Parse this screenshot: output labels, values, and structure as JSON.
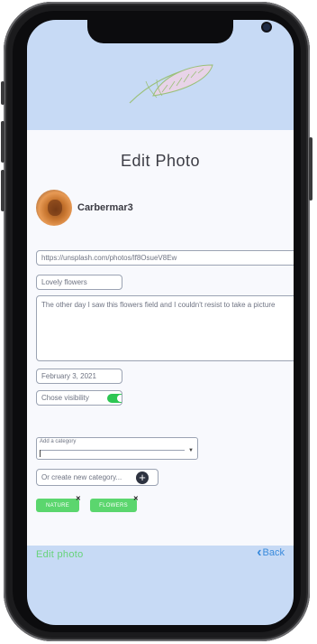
{
  "page": {
    "title": "Edit Photo",
    "user": {
      "name": "Carbermar3"
    },
    "url_value": "https://unsplash.com/photos/lf8OsueV8Ew",
    "title_value": "Lovely flowers",
    "description_value": "The other day I saw this flowers field and I couldn't resist to take a picture",
    "date_value": "February 3, 2021",
    "visibility_label": "Chose visibility",
    "category_label": "Add a category",
    "new_category_placeholder": "Or create new category...",
    "tags": [
      "NATURE",
      "FLOWERS"
    ],
    "edit_action": "Edit photo",
    "back_label": "Back"
  },
  "colors": {
    "screen_background": "#c7daf5",
    "content_background": "#f8f9fd",
    "tag_green": "#5bd66e",
    "toggle_green": "#2dc653",
    "edit_green": "#67d37a",
    "back_blue": "#3a8bdc"
  },
  "icons": {
    "feather": "feather-icon",
    "back": "chevron-left-icon",
    "add": "plus-circle-icon",
    "remove_tag": "close-icon"
  },
  "state": {
    "visibility_on": true
  }
}
